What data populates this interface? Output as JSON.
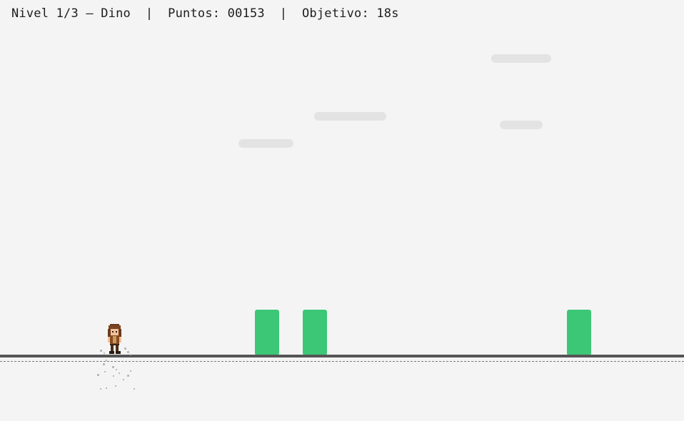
{
  "hud": {
    "level": "Nivel 1/3 — Dino",
    "separator": "|",
    "score": "Puntos: 00153",
    "goal": "Objetivo: 18s"
  },
  "colors": {
    "background": "#f4f4f4",
    "ground": "#555555",
    "obstacle": "#3cc776",
    "cloud": "#e3e3e3"
  },
  "player": {
    "icon": "runner-character-sprite"
  }
}
